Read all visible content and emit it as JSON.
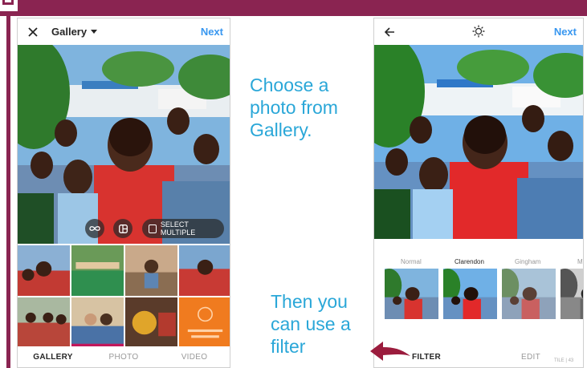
{
  "colors": {
    "frame": "#8a2451",
    "accent_blue": "#3897f0",
    "caption": "#2aa7d8",
    "arrow": "#9b1c3d"
  },
  "left_phone": {
    "header": {
      "close_icon": "close-icon",
      "title": "Gallery",
      "dropdown_icon": "chevron-down-icon",
      "next_label": "Next"
    },
    "overlay": {
      "loop_icon": "infinity-icon",
      "layout_icon": "layout-icon",
      "select_multiple_label": "SELECT MULTIPLE"
    },
    "tabs": [
      {
        "label": "GALLERY",
        "active": true
      },
      {
        "label": "PHOTO",
        "active": false
      },
      {
        "label": "VIDEO",
        "active": false
      }
    ]
  },
  "right_phone": {
    "header": {
      "back_icon": "arrow-left-icon",
      "center_icon": "brightness-icon",
      "next_label": "Next"
    },
    "filters": [
      {
        "name": "Normal",
        "active": false
      },
      {
        "name": "Clarendon",
        "active": true
      },
      {
        "name": "Gingham",
        "active": false
      },
      {
        "name": "M",
        "active": false
      }
    ],
    "tabs": [
      {
        "label": "FILTER",
        "active": true
      },
      {
        "label": "EDIT",
        "active": false
      }
    ]
  },
  "captions": {
    "step1": "Choose a photo from Gallery.",
    "step2": "Then you can use a filter"
  },
  "footer_text": "TILE | 43"
}
